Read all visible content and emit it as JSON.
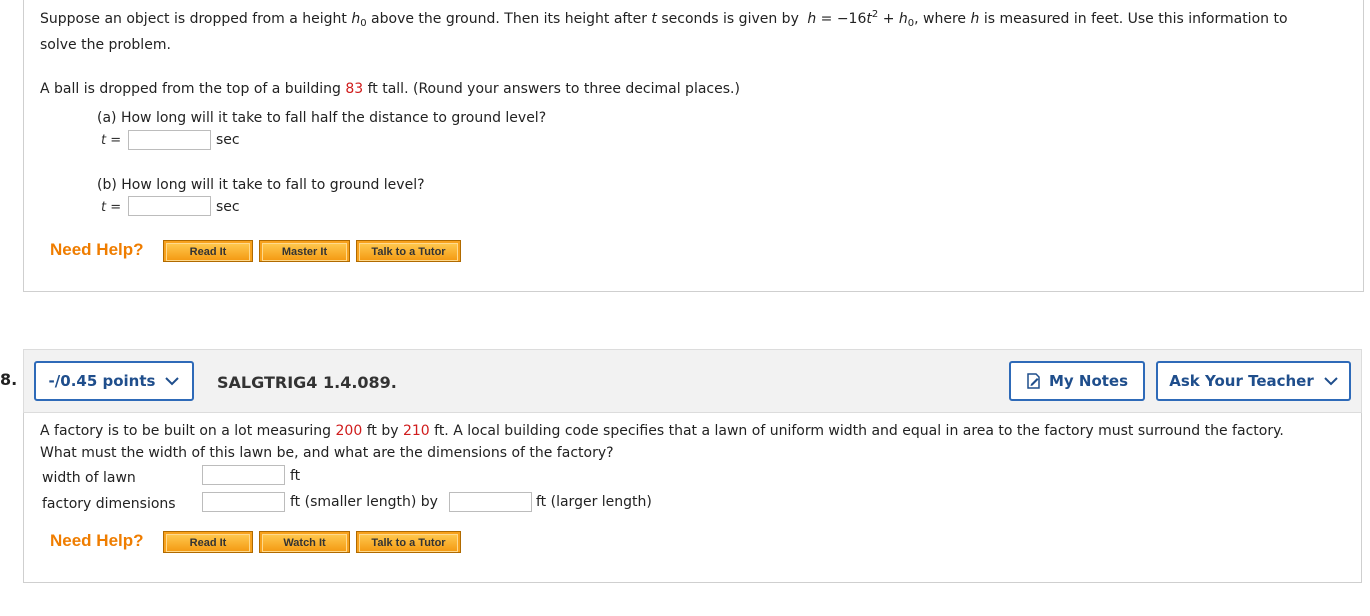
{
  "q7": {
    "intro_1": "Suppose an object is dropped from a height ",
    "h0_h": "h",
    "h0_sub": "0",
    "intro_2": " above the ground. Then its height after ",
    "t_var": "t",
    "intro_3": " seconds is given by ",
    "eq_h": "h",
    "eq_mid": " = −16",
    "eq_t": "t",
    "eq_exp": "2",
    "eq_plus": " + ",
    "eq_h0": "h",
    "eq_h0_sub": "0",
    "eq_comma": ",",
    "intro_4": " where ",
    "intro_h": "h",
    "intro_5": " is measured in feet. Use this information to",
    "intro_line2": "solve the problem.",
    "problem_1": "A ball is dropped from the top of a building ",
    "height_value": "83",
    "problem_2": " ft tall. (Round your answers to three decimal places.)",
    "part_a": "(a) How long will it take to fall half the distance to ground level?",
    "part_b": "(b) How long will it take to fall to ground level?",
    "t_label": "t",
    "eq_sign": " =",
    "unit_sec": "sec",
    "answer_a": "",
    "answer_b": "",
    "need_help": "Need Help?",
    "buttons": [
      "Read It",
      "Master It",
      "Talk to a Tutor"
    ]
  },
  "q8": {
    "number": "8.",
    "points": "-/0.45 points",
    "id": "SALGTRIG4 1.4.089.",
    "my_notes": "My Notes",
    "ask_teacher": "Ask Your Teacher",
    "text_1": "A factory is to be built on a lot measuring ",
    "lot_w": "200",
    "text_2": " ft by ",
    "lot_l": "210",
    "text_3": " ft. A local building code specifies that a lawn of uniform width and equal in area to the factory must surround the factory.",
    "text_line2": "What must the width of this lawn be, and what are the dimensions of the factory?",
    "width_label": "width of lawn",
    "width_unit": "ft",
    "dims_label": "factory dimensions",
    "dims_unit1": "ft (smaller length) by",
    "dims_unit2": "ft (larger length)",
    "answer_width": "",
    "answer_small": "",
    "answer_large": "",
    "need_help": "Need Help?",
    "buttons": [
      "Read It",
      "Watch It",
      "Talk to a Tutor"
    ]
  },
  "colors": {
    "accent_red": "#d01c1c",
    "help_orange": "#ef7d00",
    "button_blue": "#2e6ab8",
    "helper_button": "#f7a11d"
  },
  "icons": {
    "chevron": "chevron-down-icon",
    "notes": "notes-icon"
  }
}
